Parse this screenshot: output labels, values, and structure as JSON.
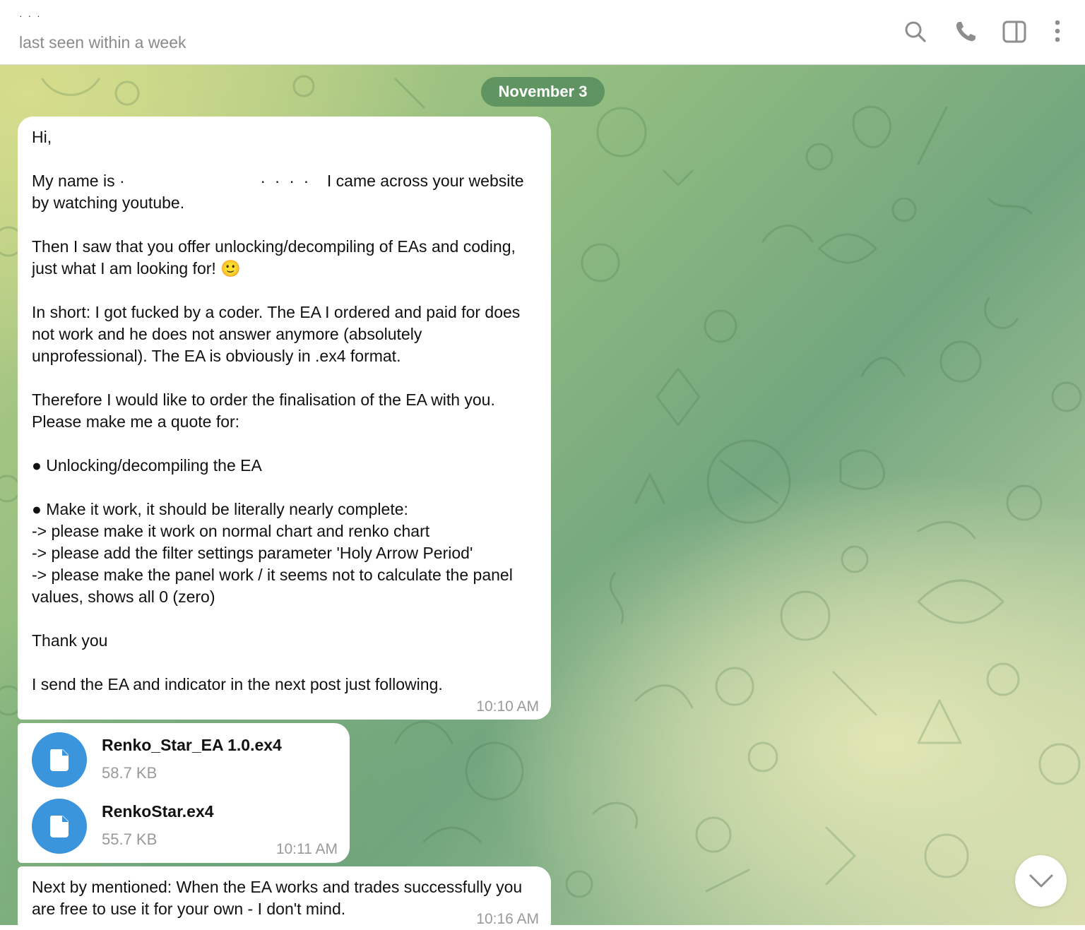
{
  "header": {
    "contact_name": "· · ·",
    "status": "last seen within a week",
    "icons": [
      "search-icon",
      "phone-icon",
      "sidebar-toggle-icon",
      "more-vertical-icon"
    ]
  },
  "chat": {
    "date_label": "November 3",
    "messages": [
      {
        "text": "Hi,\n\nMy name is ·                              ·  ·  ·  ·    I came across your website by watching youtube.\n\nThen I saw that you offer unlocking/decompiling of EAs and coding, just what I am looking for! 🙂\n\nIn short: I got fucked by a coder. The EA I ordered and paid for does not work and he does not answer anymore (absolutely unprofessional). The EA is obviously in .ex4 format.\n\nTherefore I would like to order the finalisation of the EA with you. Please make me a quote for:\n\n● Unlocking/decompiling the EA\n\n● Make it work, it should be literally nearly complete:\n-> please make it work on normal chart and renko chart\n-> please add the filter settings parameter 'Holy Arrow Period'\n-> please make the panel work / it seems not to calculate the panel values, shows all 0 (zero)\n\nThank you\n\nI send the EA and indicator in the next post just following.",
        "time": "10:10 AM"
      },
      {
        "files": [
          {
            "name": "Renko_Star_EA 1.0.ex4",
            "size": "58.7 KB",
            "icon": "file-icon"
          },
          {
            "name": "RenkoStar.ex4",
            "size": "55.7 KB",
            "icon": "file-icon"
          }
        ],
        "time": "10:11 AM"
      },
      {
        "text": "Next by mentioned: When the EA works and trades successfully you are free to use it for your own - I don't mind.",
        "time": "10:16 AM"
      }
    ],
    "scroll_button_icon": "chevron-down-icon"
  },
  "colors": {
    "accent": "#3a95dc",
    "date_pill": "#568c5c",
    "time_text": "#9a9a9a"
  }
}
